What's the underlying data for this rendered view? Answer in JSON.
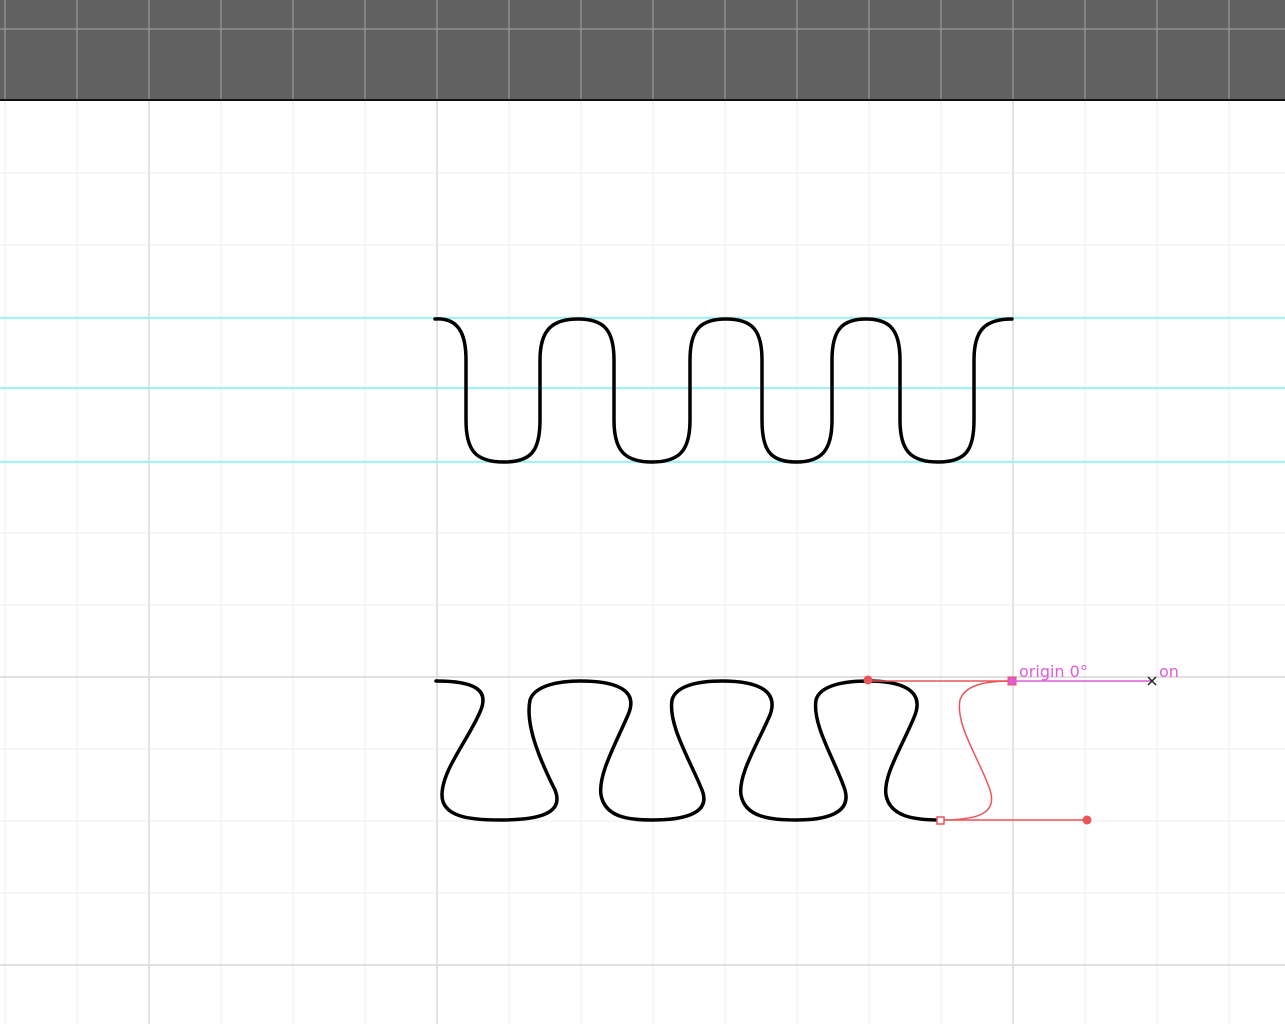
{
  "app": {
    "colors": {
      "ruler_bg": "#616161",
      "ruler_grid": "#9a9a9a",
      "canvas_bg": "#ffffff",
      "grid_minor": "#ececec",
      "grid_major": "#d6d6d6",
      "guide": "#7ff3f5",
      "stroke": "#000000",
      "selection": "#e8565a",
      "annotation": "#e05bd8"
    }
  },
  "annotations": {
    "origin_label": "origin 0°",
    "end_label": "on"
  }
}
